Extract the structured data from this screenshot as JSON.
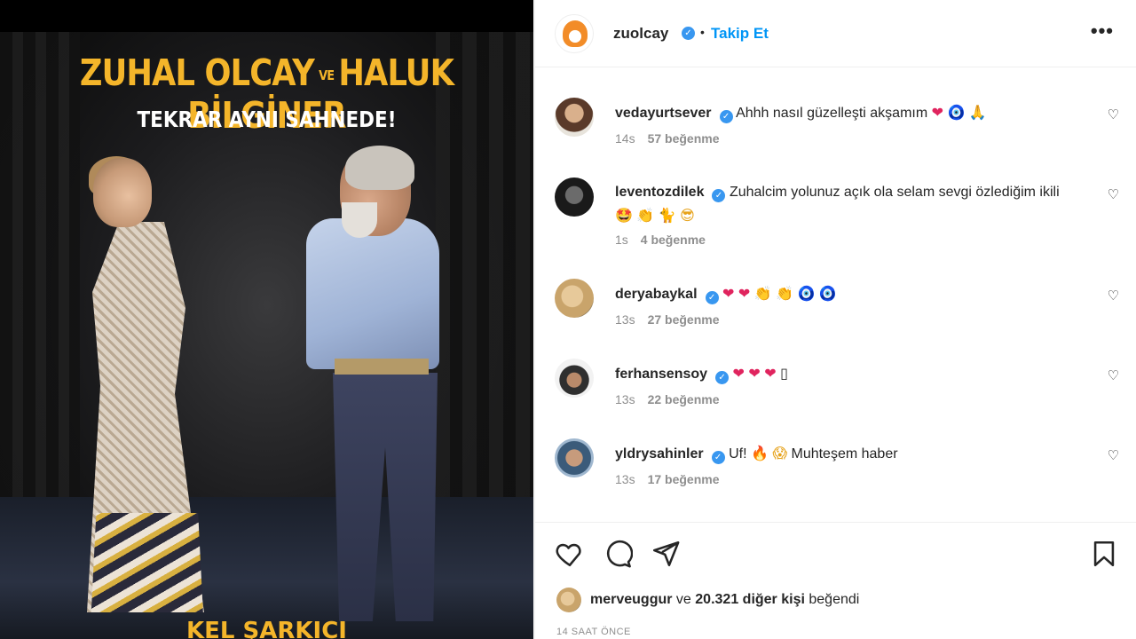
{
  "post_image": {
    "title_name1": "ZUHAL OLCAY",
    "title_ve": "VE",
    "title_name2": "HALUK BİLGİNER",
    "subtitle": "TEKRAR AYNI SAHNEDE!",
    "bottom_text": "KEL ŞARKICI"
  },
  "header": {
    "username": "zuolcay",
    "verified_icon": "✓",
    "dot": "•",
    "follow_label": "Takip Et",
    "more_label": "•••"
  },
  "comments": [
    {
      "username": "vedayurtsever",
      "text": "Ahhh nasıl güzelleşti akşamım",
      "emojis": [
        "❤",
        "🧿",
        "🙏"
      ],
      "time": "14s",
      "likes": "57 beğenme"
    },
    {
      "username": "leventozdilek",
      "text": "Zuhalcim yolunuz açık ola selam sevgi özlediğim ikili",
      "emojis": [
        "🤩",
        "👏",
        "🐈",
        "😎"
      ],
      "time": "1s",
      "likes": "4 beğenme"
    },
    {
      "username": "deryabaykal",
      "text": "",
      "emojis": [
        "❤",
        "❤",
        "👏",
        "👏",
        "🧿",
        "🧿"
      ],
      "time": "13s",
      "likes": "27 beğenme"
    },
    {
      "username": "ferhansensoy",
      "text": "",
      "emojis": [
        "❤",
        "❤",
        "❤",
        "▯"
      ],
      "time": "13s",
      "likes": "22 beğenme"
    },
    {
      "username": "yldrysahinler",
      "text": "Uf!",
      "emojis": [
        "🔥",
        "😱"
      ],
      "text2": "Muhteşem haber",
      "time": "13s",
      "likes": "17 beğenme"
    }
  ],
  "likes_row": {
    "user": "merveuggur",
    "middle": "ve",
    "others": "20.321 diğer kişi",
    "suffix": "beğendi"
  },
  "timestamp": "14 SAAT ÖNCE",
  "icons": {
    "heart": "♡"
  }
}
